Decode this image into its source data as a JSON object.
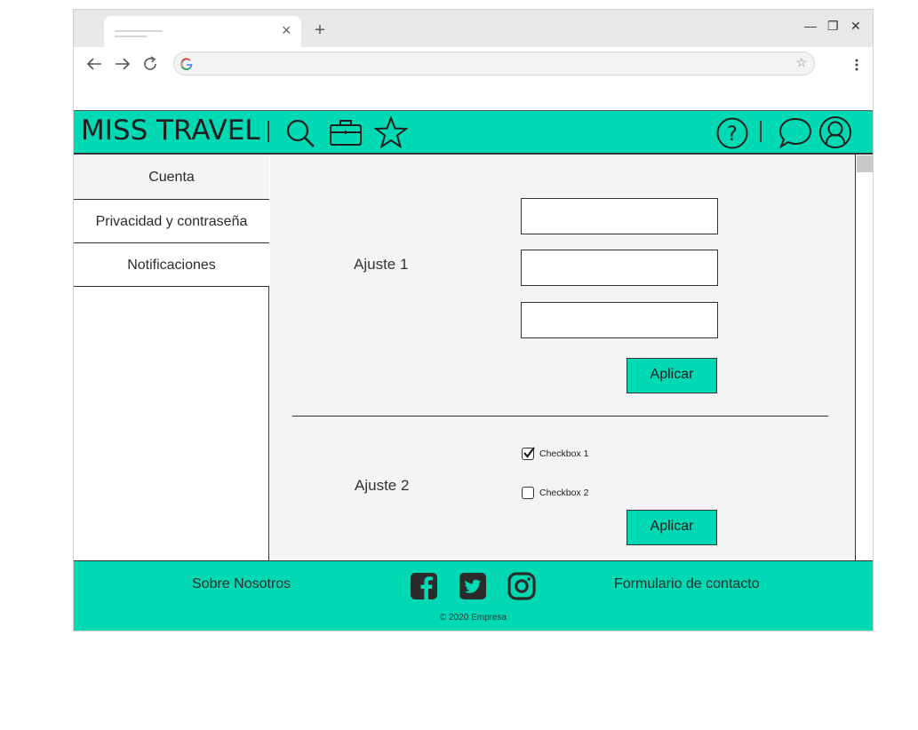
{
  "colors": {
    "accent": "#00d9b4",
    "panel": "#f4f4f4",
    "dark": "#333333"
  },
  "browser": {
    "tab_close": "×",
    "new_tab": "+",
    "window": {
      "minimize": "—",
      "maximize": "❐",
      "close": "✕"
    },
    "address_star": "☆"
  },
  "header": {
    "brand": "MISS TRAVEL",
    "icons": [
      "search-icon",
      "briefcase-icon",
      "star-icon",
      "help-icon",
      "chat-icon",
      "user-icon"
    ]
  },
  "sidebar": {
    "items": [
      {
        "label": "Cuenta"
      },
      {
        "label": "Privacidad y contraseña"
      },
      {
        "label": "Notificaciones"
      }
    ]
  },
  "settings": {
    "section1": {
      "label": "Ajuste 1",
      "fields": [
        "",
        "",
        ""
      ],
      "apply": "Aplicar"
    },
    "section2": {
      "label": "Ajuste 2",
      "checkboxes": [
        {
          "label": "Checkbox 1",
          "checked": true
        },
        {
          "label": "Checkbox 2",
          "checked": false
        }
      ],
      "apply": "Aplicar"
    }
  },
  "footer": {
    "about": "Sobre Nosotros",
    "contact": "Formulario de contacto",
    "copyright": "© 2020 Empresa",
    "social": [
      "facebook-icon",
      "twitter-icon",
      "instagram-icon"
    ]
  }
}
